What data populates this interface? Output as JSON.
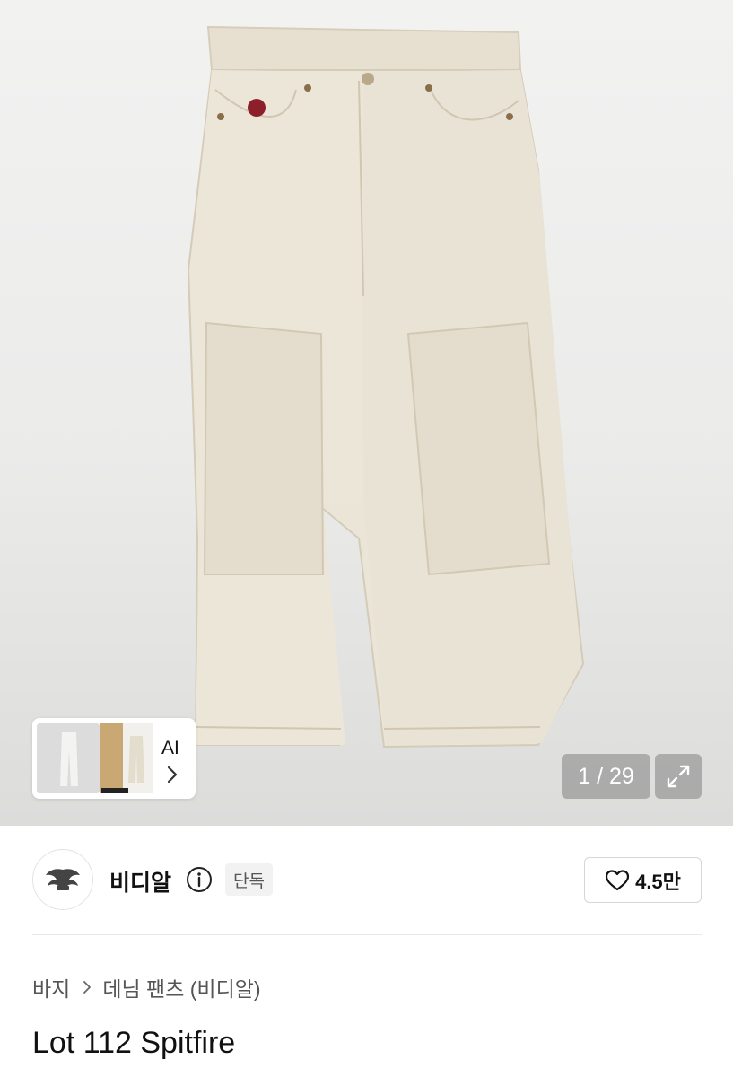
{
  "gallery": {
    "counter": "1 / 29",
    "ai_label": "AI"
  },
  "brand": {
    "name": "비디알",
    "badge": "단독",
    "likes": "4.5만"
  },
  "breadcrumb": {
    "category": "바지",
    "subcategory": "데님 팬츠 (비디알)"
  },
  "product": {
    "title": "Lot 112 Spitfire",
    "color": "#e8e2d4"
  },
  "icons": {
    "info": "info-icon",
    "heart": "heart-icon",
    "expand": "expand-icon",
    "chevron": "chevron-right-icon"
  }
}
